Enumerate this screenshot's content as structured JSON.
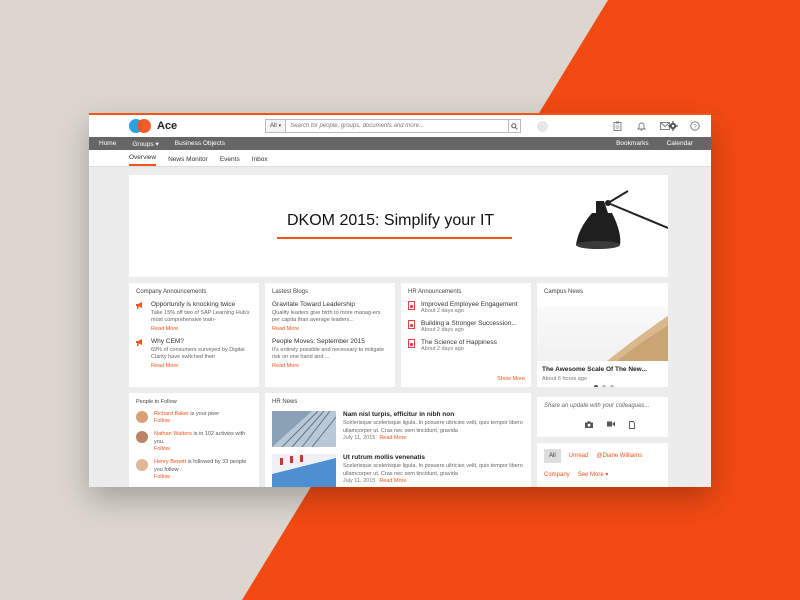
{
  "app": {
    "name": "Ace"
  },
  "colors": {
    "accent": "#f2541b",
    "nav_bg": "#666666",
    "logo_blue": "#2aa0e5"
  },
  "search": {
    "scope": "All",
    "placeholder": "Search for people, groups, documents and more..."
  },
  "top_icons": [
    "clipboard-icon",
    "bell-icon",
    "mail-icon",
    "gear-icon",
    "help-icon"
  ],
  "nav": {
    "items": [
      "Home",
      "Groups",
      "Business Objects"
    ],
    "groups_caret": "▾",
    "right": [
      "Bookmarks",
      "Calendar"
    ]
  },
  "subnav": {
    "tabs": [
      "Overview",
      "News Monitor",
      "Events",
      "Inbox"
    ],
    "active": "Overview"
  },
  "banner": {
    "title": "DKOM 2015: Simplify your IT"
  },
  "company_announcements": {
    "title": "Company Announcements",
    "items": [
      {
        "title": "Opportunity is knocking twice",
        "body": "Take 15% off two of SAP Learning Hub's most comprehensive train-",
        "link": "Read More"
      },
      {
        "title": "Why CEM?",
        "body": "69% of consumers surveyed by Digital Clarity have switched their",
        "link": "Read More"
      }
    ]
  },
  "latest_blogs": {
    "title": "Lastest Blogs",
    "items": [
      {
        "title": "Gravitate Toward Leadership",
        "body": "Quality leaders give birth to more manag-ers per capita than average leaders...",
        "link": "Read More"
      },
      {
        "title": "People Moves: September 2015",
        "body": "It's entirely possible and necessary to mitigate risk on one hand and ...",
        "link": "Read More"
      }
    ]
  },
  "hr_announcements": {
    "title": "HR Announcements",
    "items": [
      {
        "title": "Improved Employee Engagement",
        "date": "About 2 days ago"
      },
      {
        "title": "Building a Stronger Succession...",
        "date": "About 2 days ago"
      },
      {
        "title": "The Science of Happiness",
        "date": "About 2 days ago"
      }
    ],
    "show_more": "Show More"
  },
  "campus_news": {
    "title": "Campus News",
    "caption": "The Awesome Scale Of The New...",
    "date": "About 6 hours ago",
    "slide_count": 3,
    "active_slide": 1
  },
  "people_to_follow": {
    "title": "People to Follow",
    "items": [
      {
        "name": "Richard Baker",
        "text": " is your peer",
        "action": "Follow",
        "avatar_color": "#d9a07a"
      },
      {
        "name": "Nathan Watters",
        "text": " is in 102 activies with you.",
        "action": "Follow",
        "avatar_color": "#b98566"
      },
      {
        "name": "Henry Benett",
        "text": " is followed by 33 people you follow",
        "action": "Follow",
        "avatar_color": "#e0b899"
      }
    ]
  },
  "hr_news": {
    "title": "HR News",
    "items": [
      {
        "title": "Nam nisl turpis, efficitur in nibh non",
        "body": "Scelerisque scelerisque ligula. In posuere ultricies velit, quis tempor libero ullamcorper ut. Cras nec sem tincidunt, gravida",
        "date": "July 11, 2015",
        "link": "Read More"
      },
      {
        "title": "Ut rutrum mollis venenatis",
        "body": "Scelerisque scelerisque ligula. In posuere ultricies velit, quis tempor libero ullamcorper ut. Cras nec sem tincidunt, gravida",
        "date": "July 11, 2015",
        "link": "Read More"
      }
    ]
  },
  "share": {
    "placeholder": "Share an update with your colleagues...",
    "icons": [
      "camera-icon",
      "video-icon",
      "document-icon"
    ]
  },
  "feed_filters": {
    "row1": [
      "All",
      "Unread",
      "@Diane Williams"
    ],
    "row2": [
      "Company",
      "See More ▾"
    ]
  }
}
